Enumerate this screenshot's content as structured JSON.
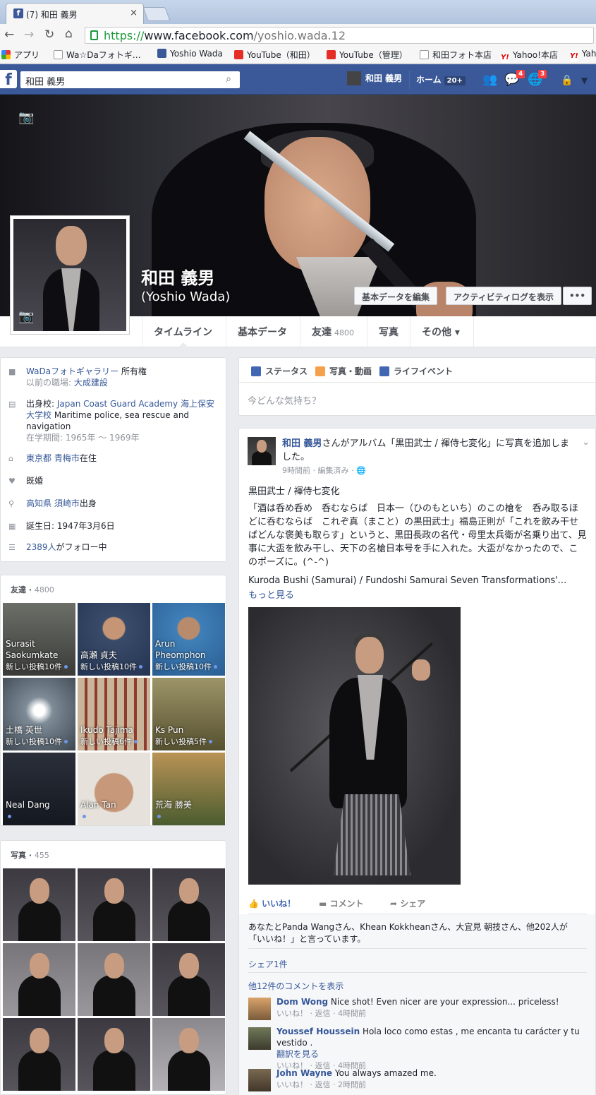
{
  "browser": {
    "tab_title": "(7) 和田 義男",
    "tab_close": "×",
    "url_https": "https://",
    "url_domain": "www.facebook.com",
    "url_path": "/yoshio.wada.12",
    "bookmarks": [
      "アプリ",
      "Wa☆Daフォトギ…",
      "Yoshio Wada",
      "YouTube（和田）",
      "YouTube（管理）",
      "和田フォト本店",
      "Yahoo!本店",
      "Yah"
    ]
  },
  "fbbar": {
    "search_value": "和田 義男",
    "user_name": "和田 義男",
    "home_label": "ホーム",
    "home_count": "20+",
    "messages_badge": "4",
    "notifications_badge": "3"
  },
  "profile": {
    "name": "和田 義男",
    "alt_name": "(Yoshio Wada)",
    "edit_button": "基本データを編集",
    "activity_button": "アクティビティログを表示",
    "more_button": "•••"
  },
  "tabs": [
    {
      "label": "タイムライン",
      "count": ""
    },
    {
      "label": "基本データ",
      "count": ""
    },
    {
      "label": "友達",
      "count": "4800"
    },
    {
      "label": "写真",
      "count": ""
    },
    {
      "label": "その他 ▾",
      "count": ""
    }
  ],
  "intro": {
    "work_place": "WaDaフォトギャラリー",
    "work_suffix": " 所有権",
    "prev_work_prefix": "以前の職場: ",
    "prev_work": "大成建設",
    "school_prefix": "出身校: ",
    "school": "Japan Coast Guard Academy 海上保安大学校",
    "school_desc": " Maritime police, sea rescue and navigation",
    "school_period": "在学期間: 1965年 ～ 1969年",
    "lives": "東京都 青梅市",
    "lives_suffix": "在住",
    "relationship": "既婚",
    "from": "高知県 須崎市",
    "from_suffix": "出身",
    "birthday": "誕生日: 1947年3月6日",
    "followers": "2389人",
    "followers_suffix": "がフォロー中"
  },
  "friends": {
    "title": "友達",
    "count": "4800",
    "items": [
      {
        "name": "Surasit Saokumkate",
        "note": "新しい投稿10件"
      },
      {
        "name": "高瀬 貞夫",
        "note": "新しい投稿10件"
      },
      {
        "name": "Arun Pheomphon",
        "note": "新しい投稿10件"
      },
      {
        "name": "土橋 英世",
        "note": "新しい投稿10件"
      },
      {
        "name": "Ikudo Tajima",
        "note": "新しい投稿6件"
      },
      {
        "name": "Ks Pun",
        "note": "新しい投稿5件"
      },
      {
        "name": "Neal Dang",
        "note": ""
      },
      {
        "name": "Alan Tan",
        "note": ""
      },
      {
        "name": "荒海 勝美",
        "note": ""
      }
    ]
  },
  "photos": {
    "title": "写真",
    "count": "455"
  },
  "composer": {
    "status": "ステータス",
    "photo_video": "写真・動画",
    "life_event": "ライフイベント",
    "placeholder": "今どんな気持ち？"
  },
  "post": {
    "author": "和田 義男",
    "action": "さんがアルバム「黒田武士 / 褌侍七変化」に写真を追加しました。",
    "meta": "9時間前 · 編集済み · 🌐",
    "title": "黒田武士 / 褌侍七変化",
    "body": "「酒は呑め呑め　呑むならば　日本一（ひのもといち）のこの槍を　呑み取るほどに呑むならば　これぞ真（まこと）の黒田武士」福島正則が「これを飲み干せばどんな褒美も取らす」というと、黒田長政の名代・母里太兵衛が名乗り出て、見事に大盃を飲み干し、天下の名槍日本号を手に入れた。大盃がなかったので、このポーズに。(^-^)",
    "english": "Kuroda Bushi (Samurai) / Fundoshi Samurai Seven Transformations'...",
    "see_more": "もっと見る",
    "like": "いいね！",
    "comment": "コメント",
    "share": "シェア",
    "likes_text": "あなたとPanda Wangさん、Khean Kokkheanさん、大宜見 朝技さん、他202人が「いいね！」と言っています。",
    "shares_text": "シェア1件",
    "more_comments": "他12件のコメントを表示",
    "comments": [
      {
        "name": "Dom Wong",
        "text": "Nice shot! Even nicer are your expression... priceless!",
        "extra": "",
        "meta": "いいね！ · 返信 · 4時間前"
      },
      {
        "name": "Youssef Houssein",
        "text": "Hola loco como estas , me encanta tu carácter y tu vestido .",
        "extra": "翻訳を見る",
        "meta": "いいね！ · 返信 · 4時間前"
      },
      {
        "name": "John Wayne",
        "text": "You always amazed me.",
        "extra": "",
        "meta": "いいね！ · 返信 · 2時間前"
      }
    ]
  },
  "colors": {
    "fb_blue": "#3b5998",
    "link": "#365899",
    "badge": "#fa3e3e"
  }
}
